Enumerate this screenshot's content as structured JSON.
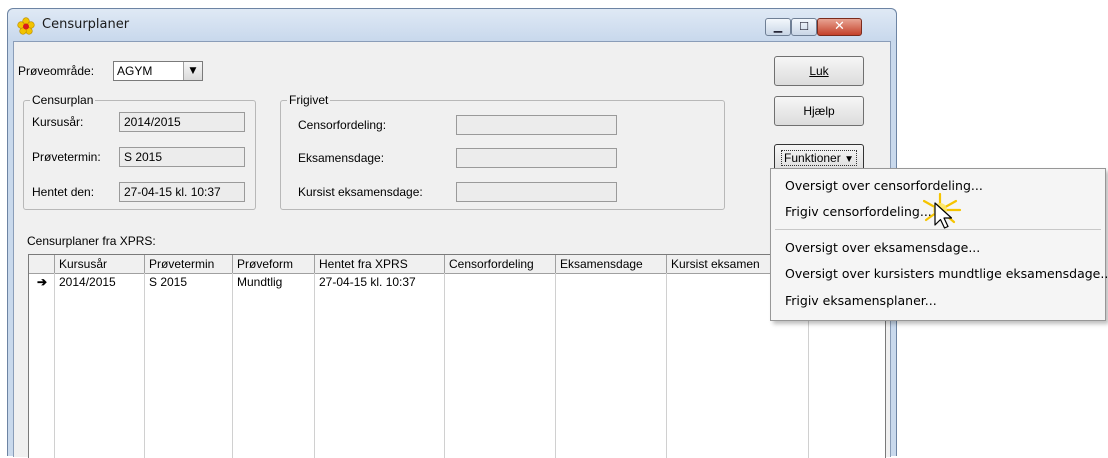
{
  "window": {
    "title": "Censurplaner"
  },
  "provearea": {
    "label": "Prøveområde:",
    "value": "AGYM"
  },
  "censurplan": {
    "title": "Censurplan",
    "kursusaar_label": "Kursusår:",
    "kursusaar_value": "2014/2015",
    "provetermin_label": "Prøvetermin:",
    "provetermin_value": "S 2015",
    "hentet_label": "Hentet den:",
    "hentet_value": "27-04-15 kl. 10:37"
  },
  "frigivet": {
    "title": "Frigivet",
    "censorfordeling_label": "Censorfordeling:",
    "censorfordeling_value": "",
    "eksamensdage_label": "Eksamensdage:",
    "eksamensdage_value": "",
    "kursist_label": "Kursist eksamensdage:",
    "kursist_value": ""
  },
  "buttons": {
    "luk": "Luk",
    "hjaelp": "Hjælp",
    "funktioner": "Funktioner"
  },
  "grid": {
    "caption": "Censurplaner fra XPRS:",
    "columns": [
      "Kursusår",
      "Prøvetermin",
      "Prøveform",
      "Hentet fra XPRS",
      "Censorfordeling",
      "Eksamensdage",
      "Kursist eksamen"
    ],
    "rows": [
      [
        "2014/2015",
        "S 2015",
        "Mundtlig",
        "27-04-15 kl. 10:37",
        "",
        "",
        ""
      ]
    ],
    "current_row_marker": "➔"
  },
  "menu": {
    "items": [
      "Oversigt over censorfordeling...",
      "Frigiv censorfordeling...",
      "Oversigt over eksamensdage...",
      "Oversigt over kursisters mundtlige eksamensdage...",
      "Frigiv eksamensplaner..."
    ]
  },
  "colors": {
    "frame": "#c9d9ec",
    "client": "#f0f0f0",
    "close": "#c4412a"
  },
  "icons": {
    "app": "flower-icon",
    "cursor": "arrow-cursor-icon",
    "dropdown": "triangle-down-icon"
  }
}
